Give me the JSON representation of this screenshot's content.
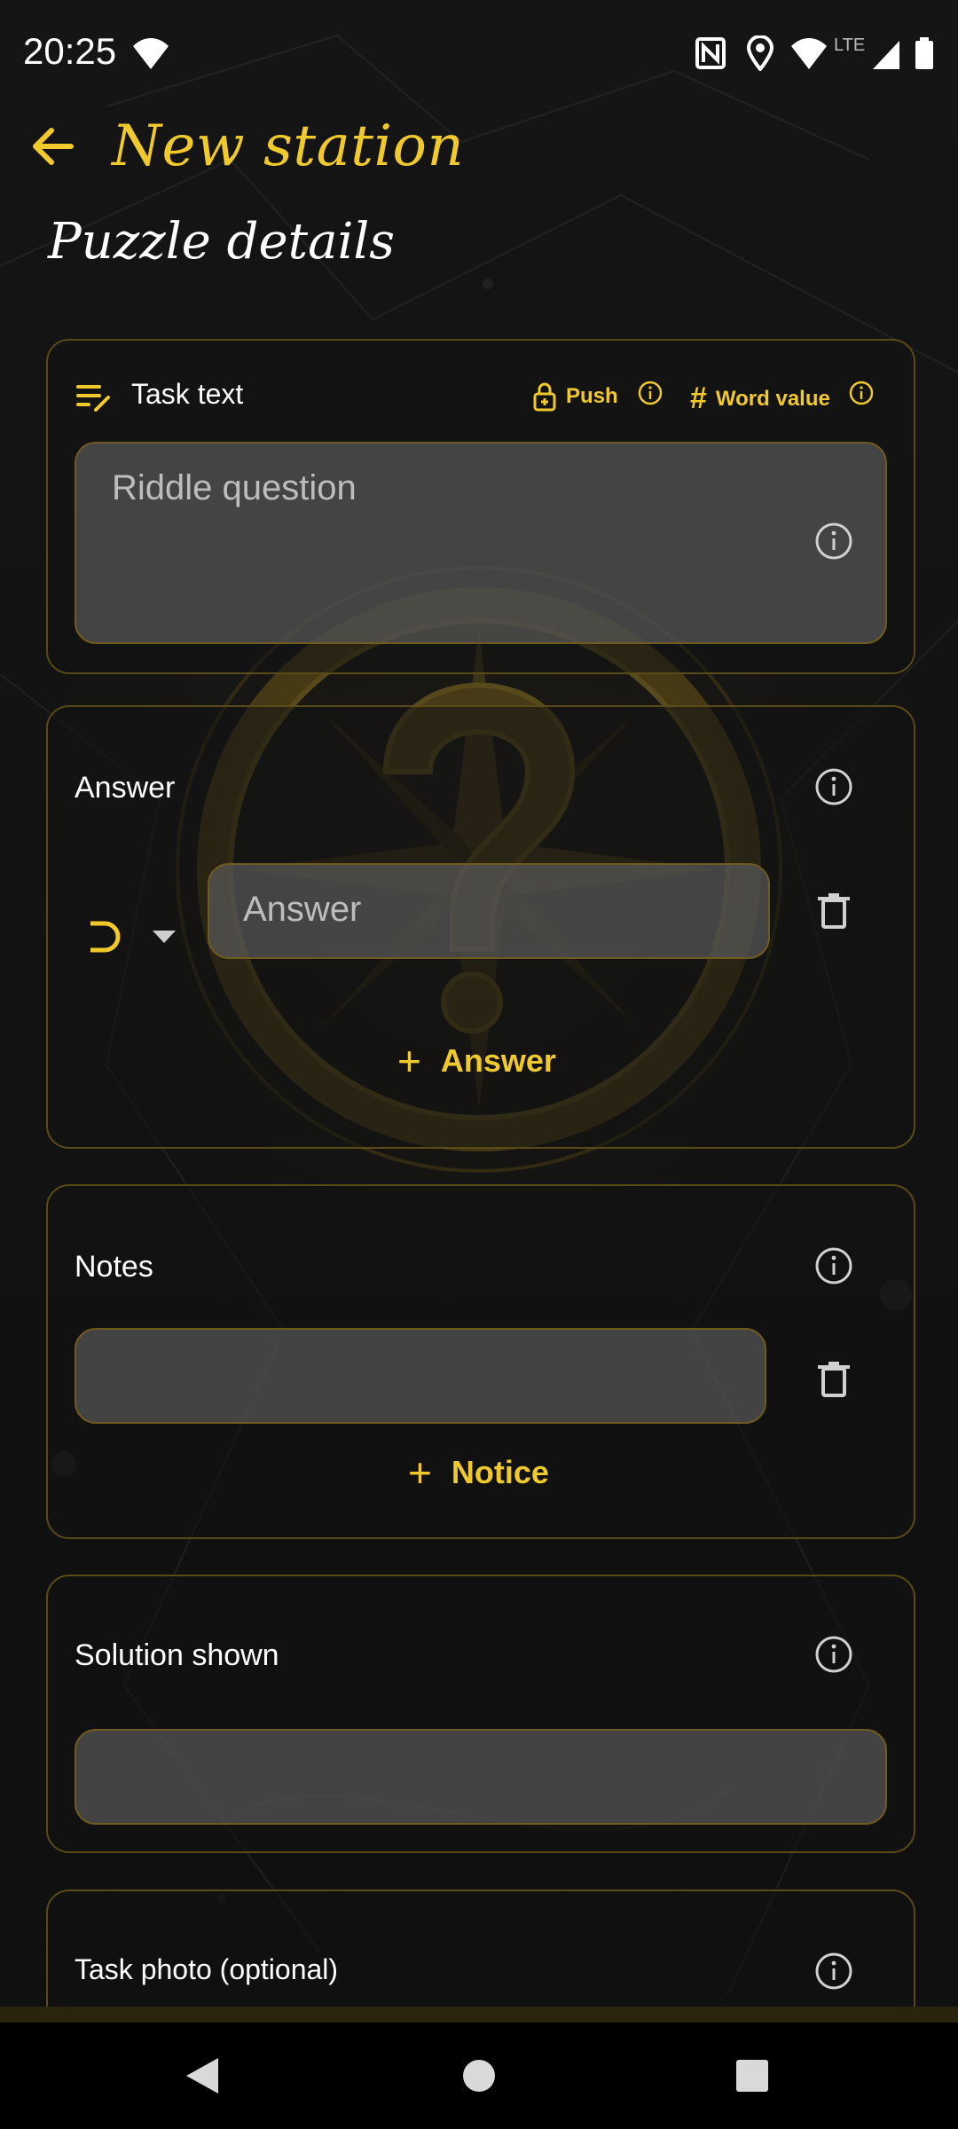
{
  "status_bar": {
    "time": "20:25",
    "icons": [
      "wifi-icon",
      "nfc-icon",
      "location-icon",
      "wifi-icon",
      "lte-icon",
      "signal-icon",
      "battery-icon"
    ],
    "lte_label": "LTE"
  },
  "appbar": {
    "back_icon": "back-arrow-icon",
    "title": "New station"
  },
  "section_title": "Puzzle details",
  "task_card": {
    "title": "Task text",
    "push_label": "Push",
    "word_value_label": "Word value",
    "riddle_placeholder": "Riddle question"
  },
  "answer_card": {
    "title": "Answer",
    "input_placeholder": "Answer",
    "add_label": "Answer"
  },
  "notes_card": {
    "title": "Notes",
    "input_value": "",
    "add_label": "Notice"
  },
  "solution_card": {
    "title": "Solution shown",
    "input_value": ""
  },
  "photo_card": {
    "title": "Task photo (optional)"
  },
  "colors": {
    "accent": "#f0c92d",
    "border": "#5a4a18",
    "field_bg": "#5f5f5f",
    "background": "#121212"
  }
}
